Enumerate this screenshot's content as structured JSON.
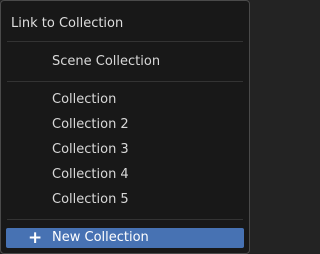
{
  "menu": {
    "title": "Link to Collection",
    "scene_collection": "Scene Collection",
    "collections": [
      "Collection",
      "Collection 2",
      "Collection 3",
      "Collection 4",
      "Collection 5"
    ],
    "new_collection": "New Collection",
    "new_icon": "+"
  }
}
